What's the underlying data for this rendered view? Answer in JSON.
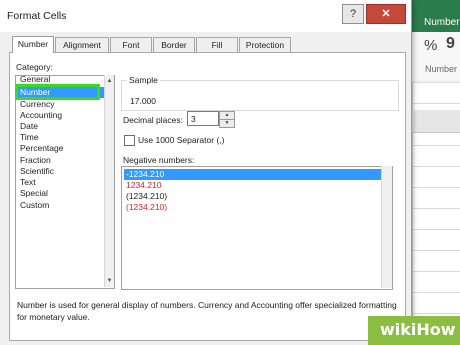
{
  "dialog": {
    "title": "Format Cells",
    "help_label": "?",
    "close_label": "✕"
  },
  "tabs": [
    {
      "label": "Number",
      "active": true
    },
    {
      "label": "Alignment"
    },
    {
      "label": "Font"
    },
    {
      "label": "Border"
    },
    {
      "label": "Fill"
    },
    {
      "label": "Protection"
    }
  ],
  "category": {
    "label": "Category:",
    "items": [
      "General",
      "Number",
      "Currency",
      "Accounting",
      "Date",
      "Time",
      "Percentage",
      "Fraction",
      "Scientific",
      "Text",
      "Special",
      "Custom"
    ],
    "selected": "Number",
    "highlight_color": "#3adb1e"
  },
  "sample": {
    "label": "Sample",
    "value": "17.000"
  },
  "decimal_places": {
    "label": "Decimal places:",
    "value": "3"
  },
  "separator": {
    "label": "Use 1000 Separator (,)",
    "checked": false
  },
  "negative_numbers": {
    "label": "Negative numbers:",
    "items": [
      {
        "text": "-1234.210",
        "selected": true
      },
      {
        "text": "1234.210",
        "red": true
      },
      {
        "text": "(1234.210)"
      },
      {
        "text": "(1234.210)",
        "red": true
      }
    ]
  },
  "description": "Number is used for general display of numbers.  Currency and Accounting offer specialized formatting for monetary value.",
  "background": {
    "right_title": "Number",
    "ribbon_percent": "%",
    "ribbon_comma": "9",
    "ribbon_group_label": "Number"
  },
  "watermark": "wikiHow",
  "colors": {
    "selection_blue": "#3399ff",
    "negative_red": "#e02020",
    "excel_green": "#217346"
  }
}
